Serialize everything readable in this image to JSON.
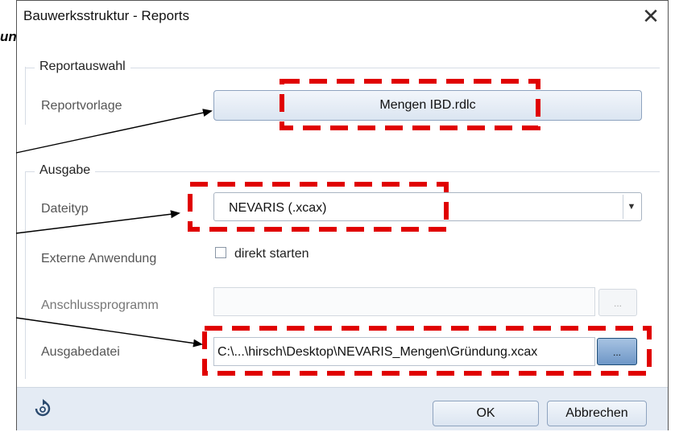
{
  "background": {
    "partial_heading": "ungen"
  },
  "window": {
    "title": "Bauwerksstruktur - Reports",
    "close_glyph": "✕"
  },
  "report_group": {
    "legend": "Reportauswahl",
    "template_label": "Reportvorlage",
    "template_value": "Mengen IBD.rdlc"
  },
  "output_group": {
    "legend": "Ausgabe",
    "filetype_label": "Dateityp",
    "filetype_value": "NEVARIS (.xcax)",
    "external_label": "Externe Anwendung",
    "external_checkbox_label": "direkt starten",
    "external_checked": false,
    "program_label": "Anschlussprogramm",
    "program_value": "",
    "browse_label": "...",
    "output_file_label": "Ausgabedatei",
    "output_file_value": "C:\\...\\hirsch\\Desktop\\NEVARIS_Mengen\\Gründung.xcax"
  },
  "footer": {
    "ok_label": "OK",
    "cancel_label": "Abbrechen",
    "reset_icon": "reset-icon"
  },
  "colors": {
    "highlight": "#e00000",
    "accent": "#1f4e79",
    "footer_bg": "#e4ebf4"
  }
}
